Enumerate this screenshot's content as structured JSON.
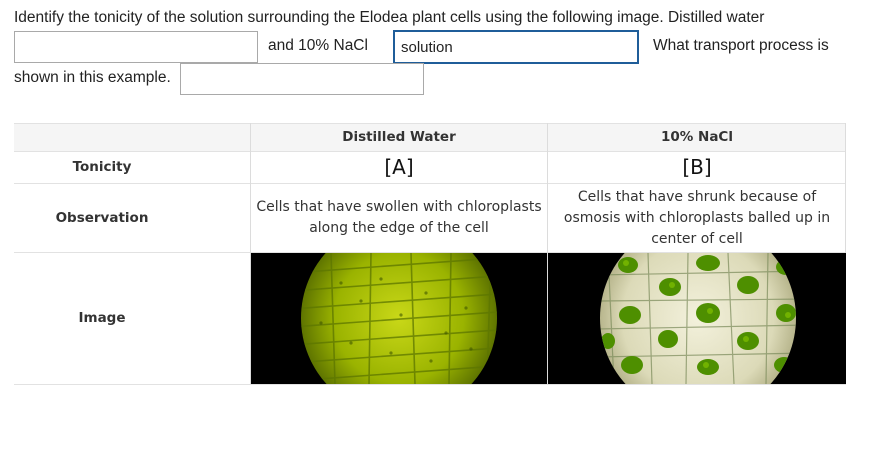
{
  "question": {
    "line1": "Identify the tonicity of the solution surrounding the Elodea plant cells using the following image. Distilled water",
    "mid_text": "and 10% NaCl",
    "after_text": "What transport process is",
    "line3": "shown in this example.",
    "answer1_value": "",
    "answer2_value": "solution",
    "answer3_value": ""
  },
  "table": {
    "columns": [
      "",
      "Distilled Water",
      "10% NaCl"
    ],
    "rows": [
      {
        "label": "Tonicity",
        "a": "[A]",
        "b": "[B]"
      },
      {
        "label": "Observation",
        "a": "Cells that have swollen with chloroplasts along the edge of the cell",
        "b": "Cells that have shrunk because of osmosis with chloroplasts balled up in center of cell"
      },
      {
        "label": "Image",
        "a": "",
        "b": ""
      }
    ]
  },
  "colors": {
    "input_active_border": "#1f5d99",
    "header_bg": "#f5f5f5",
    "cell_green_dark": "#4a6a00",
    "cell_green_bright": "#c8d81a"
  }
}
